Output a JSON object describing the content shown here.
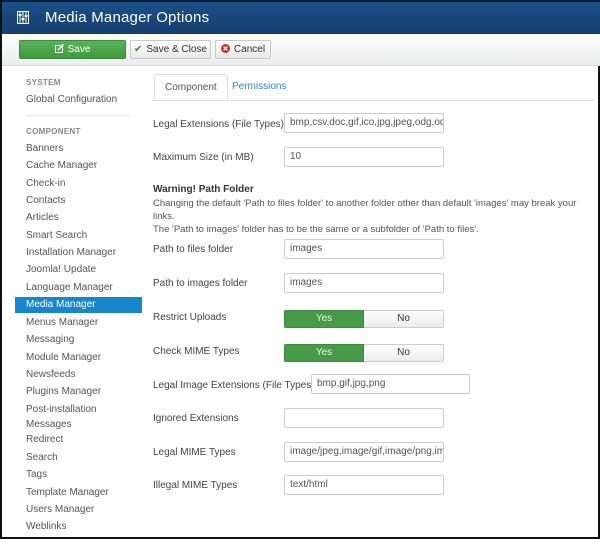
{
  "window": {
    "title": "Media Manager Options",
    "icon": "equalizer-icon",
    "accent_color": "#1b4f88"
  },
  "toolbar": {
    "save_label": "Save",
    "save_close_label": "Save & Close",
    "cancel_label": "Cancel",
    "save_color": "#4aa64a"
  },
  "sidebar": {
    "system_heading": "SYSTEM",
    "global_config": "Global Configuration",
    "component_heading": "COMPONENT",
    "items": [
      {
        "label": "Banners"
      },
      {
        "label": "Cache Manager"
      },
      {
        "label": "Check-in"
      },
      {
        "label": "Contacts"
      },
      {
        "label": "Articles"
      },
      {
        "label": "Smart Search"
      },
      {
        "label": "Installation Manager"
      },
      {
        "label": "Joomla! Update"
      },
      {
        "label": "Language Manager"
      },
      {
        "label": "Media Manager"
      },
      {
        "label": "Menus Manager"
      },
      {
        "label": "Messaging"
      },
      {
        "label": "Module Manager"
      },
      {
        "label": "Newsfeeds"
      },
      {
        "label": "Plugins Manager"
      },
      {
        "label": "Post-installation Messages"
      },
      {
        "label": "Redirect"
      },
      {
        "label": "Search"
      },
      {
        "label": "Tags"
      },
      {
        "label": "Template Manager"
      },
      {
        "label": "Users Manager"
      },
      {
        "label": "Weblinks"
      }
    ],
    "active_item": "Media Manager",
    "active_color": "#1786cc"
  },
  "tabs": [
    {
      "label": "Component",
      "active": true
    },
    {
      "label": "Permissions",
      "active": false
    }
  ],
  "form": {
    "legal_extensions": {
      "label": "Legal Extensions (File Types)",
      "value": "bmp,csv,doc,gif,ico,jpg,jpeg,odg,odp"
    },
    "maximum_size": {
      "label": "Maximum Size (in MB)",
      "value": "10"
    },
    "warning": {
      "title": "Warning! Path Folder",
      "line1": "Changing the default 'Path to files folder' to another folder other than default 'images' may break your links.",
      "line2": "The 'Path to images' folder has to be the same or a subfolder of 'Path to files'."
    },
    "path_files": {
      "label": "Path to files folder",
      "value": "images"
    },
    "path_images": {
      "label": "Path to images folder",
      "value": "images"
    },
    "restrict_uploads": {
      "label": "Restrict Uploads",
      "yes": "Yes",
      "no": "No",
      "selected": "Yes"
    },
    "check_mime": {
      "label": "Check MIME Types",
      "yes": "Yes",
      "no": "No",
      "selected": "Yes"
    },
    "legal_image_extensions": {
      "label": "Legal Image Extensions (File Types)",
      "value": "bmp,gif,jpg,png"
    },
    "ignored_extensions": {
      "label": "Ignored Extensions",
      "value": ""
    },
    "legal_mime": {
      "label": "Legal MIME Types",
      "value": "image/jpeg,image/gif,image/png,image/bmp"
    },
    "illegal_mime": {
      "label": "Illegal MIME Types",
      "value": "text/html"
    }
  }
}
